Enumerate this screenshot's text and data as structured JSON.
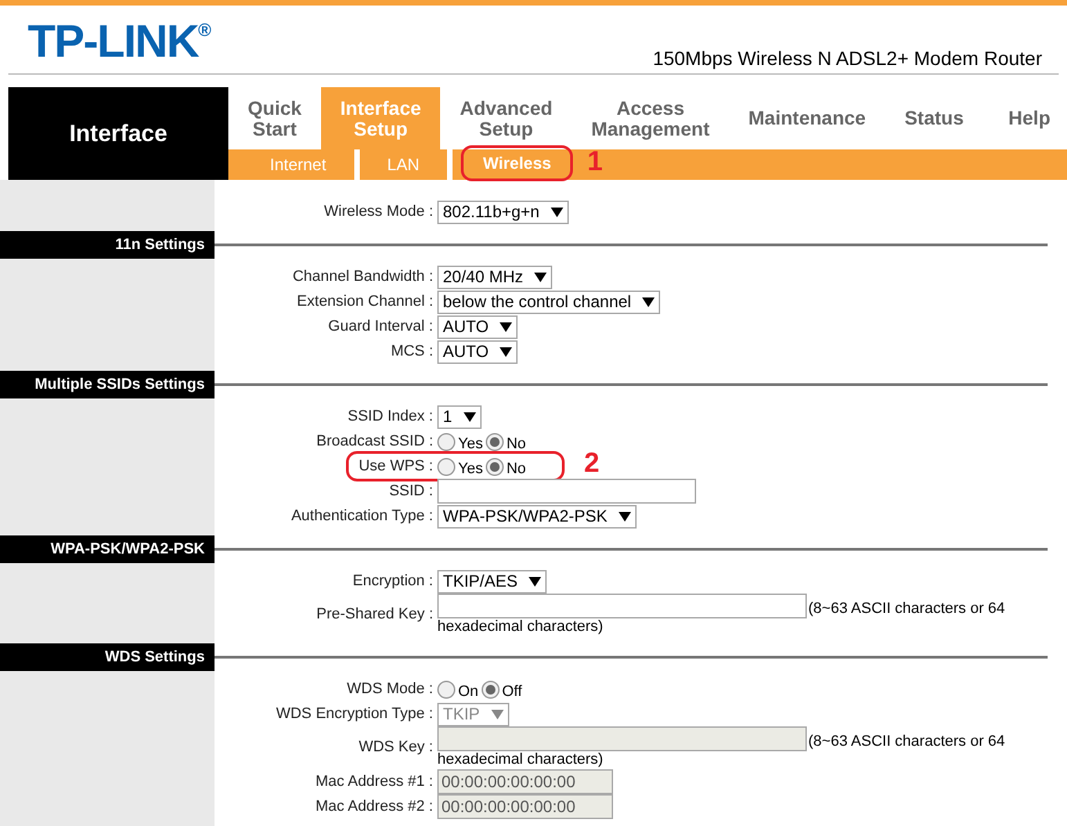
{
  "header": {
    "logo": "TP-LINK",
    "logo_mark": "®",
    "model": "150Mbps Wireless N ADSL2+ Modem Router"
  },
  "nav": {
    "section_title": "Interface",
    "tabs": [
      {
        "label": "Quick\nStart",
        "selected": false
      },
      {
        "label": "Interface\nSetup",
        "selected": true
      },
      {
        "label": "Advanced\nSetup",
        "selected": false
      },
      {
        "label": "Access\nManagement",
        "selected": false
      },
      {
        "label": "Maintenance",
        "selected": false
      },
      {
        "label": "Status",
        "selected": false
      },
      {
        "label": "Help",
        "selected": false
      }
    ],
    "subtabs": [
      {
        "label": "Internet",
        "selected": false
      },
      {
        "label": "LAN",
        "selected": false
      },
      {
        "label": "Wireless",
        "selected": true,
        "callout": "1"
      }
    ]
  },
  "sections": [
    {
      "rows": [
        {
          "kind": "select",
          "label": "Wireless Mode :",
          "value": "802.11b+g+n"
        }
      ]
    },
    {
      "title": "11n Settings",
      "rows": [
        {
          "kind": "select",
          "label": "Channel Bandwidth :",
          "value": "20/40 MHz"
        },
        {
          "kind": "select",
          "label": "Extension Channel :",
          "value": "below the control channel"
        },
        {
          "kind": "select",
          "label": "Guard Interval :",
          "value": "AUTO"
        },
        {
          "kind": "select",
          "label": "MCS :",
          "value": "AUTO"
        }
      ]
    },
    {
      "title": "Multiple SSIDs Settings",
      "rows": [
        {
          "kind": "select",
          "label": "SSID Index :",
          "value": "1"
        },
        {
          "kind": "radio",
          "label": "Broadcast SSID :",
          "options": [
            {
              "label": "Yes",
              "selected": false
            },
            {
              "label": "No",
              "selected": true
            }
          ]
        },
        {
          "kind": "radio",
          "label": "Use WPS :",
          "callout": "2",
          "options": [
            {
              "label": "Yes",
              "selected": false
            },
            {
              "label": "No",
              "selected": true
            }
          ]
        },
        {
          "kind": "text",
          "label": "SSID :"
        },
        {
          "kind": "select",
          "label": "Authentication Type :",
          "value": "WPA-PSK/WPA2-PSK"
        }
      ]
    },
    {
      "title": "WPA-PSK/WPA2-PSK",
      "rows": [
        {
          "kind": "select",
          "label": "Encryption :",
          "value": "TKIP/AES"
        },
        {
          "kind": "text",
          "label": "Pre-Shared Key :",
          "hint": [
            "(8~63 ASCII characters or 64",
            "hexadecimal characters)"
          ]
        }
      ]
    },
    {
      "title": "WDS Settings",
      "rows": [
        {
          "kind": "radio",
          "label": "WDS Mode :",
          "options": [
            {
              "label": "On",
              "selected": false
            },
            {
              "label": "Off",
              "selected": true
            }
          ]
        },
        {
          "kind": "select",
          "label": "WDS Encryption Type :",
          "value": "TKIP",
          "disabled": true
        },
        {
          "kind": "text",
          "label": "WDS Key :",
          "disabled": true,
          "hint": [
            "(8~63 ASCII characters or 64",
            "hexadecimal characters)"
          ]
        },
        {
          "kind": "text",
          "label": "Mac Address #1 :",
          "disabled": true,
          "value": "00:00:00:00:00:00"
        },
        {
          "kind": "text",
          "label": "Mac Address #2 :",
          "disabled": true,
          "value": "00:00:00:00:00:00"
        }
      ]
    }
  ]
}
